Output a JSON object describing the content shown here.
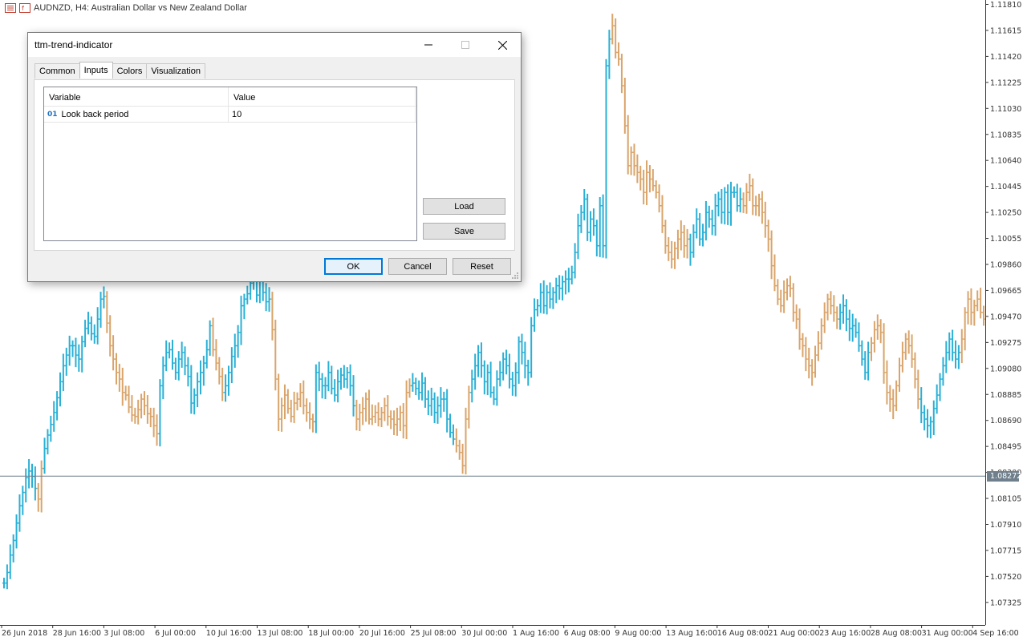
{
  "window": {
    "symbol_title": "AUDNZD, H4:  Australian Dollar vs New Zealand Dollar"
  },
  "colors": {
    "bull": "#2ab0d5",
    "bear": "#d9a46a",
    "bid_line": "#6f7f8c",
    "axis": "#333333"
  },
  "chart_data": {
    "type": "bar",
    "title": "AUDNZD, H4:  Australian Dollar vs New Zealand Dollar",
    "y_ticks": [
      "1.11810",
      "1.11615",
      "1.11420",
      "1.11225",
      "1.11030",
      "1.10835",
      "1.10640",
      "1.10445",
      "1.10250",
      "1.10055",
      "1.09860",
      "1.09665",
      "1.09470",
      "1.09275",
      "1.09080",
      "1.08885",
      "1.08690",
      "1.08495",
      "1.08300",
      "1.08105",
      "1.07910",
      "1.07715",
      "1.07520",
      "1.07325"
    ],
    "ylim": [
      1.0722,
      1.1181
    ],
    "x_ticks": [
      "26 Jun 2018",
      "28 Jun 16:00",
      "3 Jul 08:00",
      "6 Jul 00:00",
      "10 Jul 16:00",
      "13 Jul 08:00",
      "18 Jul 00:00",
      "20 Jul 16:00",
      "25 Jul 08:00",
      "30 Jul 00:00",
      "1 Aug 16:00",
      "6 Aug 08:00",
      "9 Aug 00:00",
      "13 Aug 16:00",
      "16 Aug 08:00",
      "21 Aug 00:00",
      "23 Aug 16:00",
      "28 Aug 08:00",
      "31 Aug 00:00",
      "4 Sep 16:00"
    ],
    "current_price": "1.08272",
    "current_value": 1.08272,
    "series": [
      {
        "trend": [
          1,
          1,
          1,
          1,
          1,
          1,
          1,
          1,
          1,
          1,
          1,
          0,
          0,
          1,
          1,
          1,
          1,
          1,
          1,
          1,
          1,
          1,
          1,
          1,
          1,
          1,
          1,
          1,
          1,
          1,
          1,
          1,
          1,
          0,
          0,
          0,
          0,
          0,
          0,
          0,
          0,
          0,
          0,
          0,
          0,
          0,
          0,
          0,
          0,
          0,
          1,
          1,
          1,
          1,
          1,
          1,
          1,
          1,
          1,
          1,
          1,
          1,
          1,
          1,
          1,
          1,
          1,
          0,
          0,
          0,
          0,
          1,
          1,
          1,
          1,
          1,
          1,
          1,
          1,
          1,
          1,
          1,
          1,
          1,
          1,
          1,
          0,
          0,
          0,
          0,
          0,
          0,
          0,
          0,
          0,
          0,
          0,
          0,
          0,
          0,
          1,
          1,
          1,
          1,
          1,
          1,
          1,
          1,
          1,
          1,
          1,
          1,
          1,
          0,
          0,
          0,
          0,
          0,
          0,
          0,
          0,
          0,
          0,
          0,
          0,
          0,
          0,
          0,
          0,
          0,
          0,
          1,
          1,
          1,
          1,
          1,
          1,
          1,
          1,
          1,
          1,
          1,
          1,
          1,
          1,
          0,
          0,
          0,
          0,
          0,
          1,
          1,
          1,
          1,
          1,
          1,
          1,
          1,
          1,
          1,
          1,
          1,
          1,
          1,
          1,
          1,
          1,
          1,
          1,
          1,
          1,
          1,
          1,
          1,
          1,
          1,
          1,
          1,
          1,
          1,
          1,
          1,
          1,
          1,
          1,
          1,
          1,
          1,
          1,
          1,
          1,
          1,
          1,
          1,
          1,
          0,
          0,
          0,
          0,
          0,
          0,
          0,
          0,
          0,
          0,
          0,
          0,
          0,
          0,
          0,
          0,
          0,
          0,
          0,
          0,
          0,
          0,
          0,
          0,
          0,
          1,
          1,
          1,
          1,
          1,
          1,
          1,
          1,
          1,
          1,
          1,
          1,
          1,
          1,
          1,
          1,
          1,
          0,
          0,
          0,
          0,
          0,
          0,
          0,
          0,
          0,
          0,
          0,
          0,
          0,
          0,
          0,
          0,
          0,
          0,
          0,
          0,
          0,
          0,
          0,
          0,
          0,
          0,
          0,
          0,
          0,
          0,
          0,
          1,
          1,
          1,
          1,
          1,
          1,
          1,
          1,
          1,
          1,
          0,
          0,
          0,
          0,
          0,
          0,
          0,
          0,
          0,
          0,
          0,
          0,
          0,
          0,
          0,
          0,
          1,
          1,
          1,
          1,
          1,
          1,
          1,
          1,
          1,
          1,
          1,
          1,
          1
        ],
        "close": [
          1.0747,
          1.0755,
          1.0768,
          1.0779,
          1.0792,
          1.0805,
          1.0815,
          1.0826,
          1.0831,
          1.0827,
          1.0818,
          1.081,
          1.0833,
          1.0848,
          1.0858,
          1.0866,
          1.0875,
          1.0886,
          1.0898,
          1.091,
          1.0918,
          1.0925,
          1.0925,
          1.0918,
          1.0915,
          1.0928,
          1.0938,
          1.0942,
          1.0934,
          1.0932,
          1.0945,
          1.096,
          1.0962,
          1.0942,
          1.0925,
          1.0915,
          1.0905,
          1.09,
          1.089,
          1.0888,
          1.0879,
          1.0873,
          1.0872,
          1.0877,
          1.0885,
          1.088,
          1.0874,
          1.0872,
          1.0865,
          1.0859,
          1.0895,
          1.091,
          1.092,
          1.0922,
          1.0912,
          1.0905,
          1.0915,
          1.092,
          1.091,
          1.0902,
          1.0882,
          1.0888,
          1.0898,
          1.0905,
          1.0912,
          1.0922,
          1.094,
          1.0922,
          1.0912,
          1.0902,
          1.089,
          1.0895,
          1.0905,
          1.0917,
          1.0925,
          1.0935,
          1.0955,
          1.096,
          1.0964,
          1.0972,
          1.0974,
          1.0963,
          1.0975,
          1.0965,
          1.0958,
          1.096,
          1.0937,
          1.09,
          1.087,
          1.088,
          1.0888,
          1.0878,
          1.0872,
          1.0882,
          1.0885,
          1.089,
          1.088,
          1.0875,
          1.087,
          1.0868,
          1.0905,
          1.09,
          1.0895,
          1.0895,
          1.0905,
          1.0893,
          1.0888,
          1.0898,
          1.0903,
          1.09,
          1.0905,
          1.0895,
          1.088,
          1.087,
          1.0875,
          1.0878,
          1.0885,
          1.087,
          1.0872,
          1.0875,
          1.087,
          1.0875,
          1.088,
          1.0872,
          1.087,
          1.0866,
          1.087,
          1.0875,
          1.0865,
          1.089,
          1.0895,
          1.0897,
          1.0893,
          1.089,
          1.0897,
          1.0885,
          1.088,
          1.0885,
          1.0875,
          1.088,
          1.0885,
          1.0885,
          1.087,
          1.086,
          1.0855,
          1.085,
          1.0845,
          1.0835,
          1.087,
          1.089,
          1.09,
          1.091,
          1.092,
          1.091,
          1.0898,
          1.0905,
          1.089,
          1.0885,
          1.09,
          1.0905,
          1.0915,
          1.091,
          1.09,
          1.0895,
          1.0905,
          1.0928,
          1.092,
          1.091,
          1.0905,
          1.094,
          1.0952,
          1.0955,
          1.0965,
          1.0955,
          1.0965,
          1.096,
          1.0965,
          1.097,
          1.0968,
          1.0973,
          1.0975,
          1.0975,
          1.098,
          1.0995,
          1.1015,
          1.1025,
          1.1035,
          1.101,
          1.102,
          1.1015,
          1.1,
          1.103,
          1.1,
          1.1135,
          1.1155,
          1.1165,
          1.1145,
          1.114,
          1.112,
          1.109,
          1.106,
          1.107,
          1.106,
          1.1055,
          1.105,
          1.104,
          1.1055,
          1.105,
          1.1045,
          1.104,
          1.103,
          1.1015,
          1.1,
          1.0995,
          1.099,
          1.0998,
          1.1005,
          1.101,
          1.1,
          1.1005,
          1.0995,
          1.101,
          1.102,
          1.1005,
          1.101,
          1.1025,
          1.102,
          1.1015,
          1.103,
          1.1035,
          1.1025,
          1.104,
          1.1025,
          1.104,
          1.104,
          1.103,
          1.1035,
          1.103,
          1.104,
          1.1045,
          1.103,
          1.103,
          1.1035,
          1.1025,
          1.1015,
          1.1005,
          1.0985,
          1.097,
          1.096,
          1.0955,
          1.0965,
          1.097,
          1.0968,
          1.095,
          1.0945,
          1.093,
          1.0925,
          1.0915,
          1.091,
          1.0905,
          1.0918,
          1.0927,
          1.094,
          1.095,
          1.096,
          1.0955,
          1.095,
          1.0945,
          1.095,
          1.0955,
          1.0945,
          1.0938,
          1.094,
          1.0935,
          1.0925,
          1.0915,
          1.0905,
          1.092,
          1.0927,
          1.0937,
          1.094,
          1.0935,
          1.0905,
          1.089,
          1.0885,
          1.088,
          1.0895,
          1.091,
          1.092,
          1.093,
          1.0925,
          1.0915,
          1.09,
          1.0885,
          1.0875,
          1.087,
          1.0865,
          1.0868,
          1.0878,
          1.0888,
          1.09,
          1.091,
          1.092,
          1.093,
          1.092,
          1.0915,
          1.092,
          1.093,
          1.095,
          1.096,
          1.095,
          1.0955,
          1.096,
          1.095,
          1.0945
        ]
      }
    ]
  },
  "dialog": {
    "title": "ttm-trend-indicator",
    "tabs": [
      "Common",
      "Inputs",
      "Colors",
      "Visualization"
    ],
    "active_tab": "Inputs",
    "grid": {
      "headers": [
        "Variable",
        "Value"
      ],
      "rows": [
        {
          "type_icon": "01",
          "variable": "Look back period",
          "value": "10"
        }
      ]
    },
    "load_label": "Load",
    "save_label": "Save",
    "ok_label": "OK",
    "cancel_label": "Cancel",
    "reset_label": "Reset"
  }
}
